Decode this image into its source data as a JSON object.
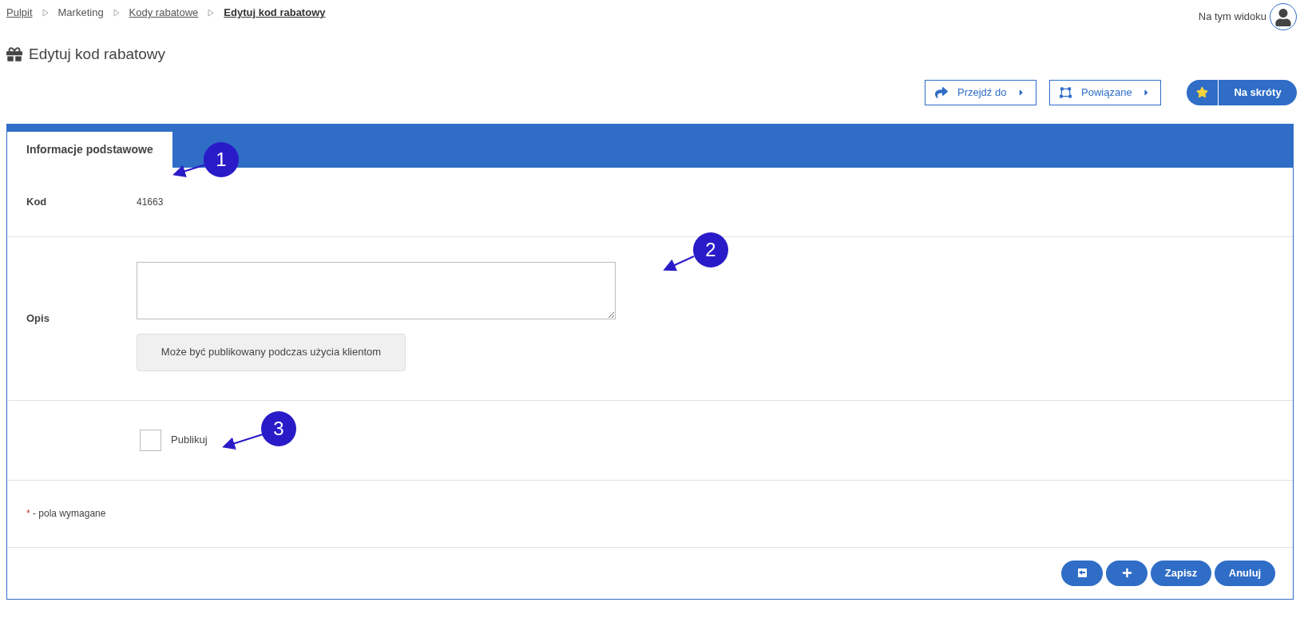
{
  "breadcrumbs": [
    {
      "label": "Pulpit",
      "link": true,
      "current": false
    },
    {
      "label": "Marketing",
      "link": false,
      "current": false
    },
    {
      "label": "Kody rabatowe",
      "link": true,
      "current": false
    },
    {
      "label": "Edytuj kod rabatowy",
      "link": true,
      "current": true
    }
  ],
  "view_label": "Na tym widoku",
  "page_title": "Edytuj kod rabatowy",
  "toolbar": [
    {
      "label": "Przejdź do",
      "kind": "goto"
    },
    {
      "label": "Powiązane",
      "kind": "related"
    }
  ],
  "shortcut_button": "Na skróty",
  "tabs": [
    {
      "label": "Informacje podstawowe",
      "selected": true
    }
  ],
  "form": {
    "code_label": "Kod",
    "code_value": "41663",
    "description_label": "Opis",
    "description_hint": "Może być publikowany podczas użycia klientom",
    "publish": {
      "label": "Publikuj",
      "checked": false
    },
    "required_mark": "*",
    "required_note": "- pola wymagane"
  },
  "footer_buttons": [
    {
      "kind": "back"
    },
    {
      "kind": "add"
    },
    {
      "kind": "text",
      "label": "Zapisz"
    },
    {
      "kind": "text",
      "label": "Anuluj"
    }
  ],
  "annotations": [
    {
      "number": "1"
    },
    {
      "number": "2"
    },
    {
      "number": "3"
    }
  ]
}
